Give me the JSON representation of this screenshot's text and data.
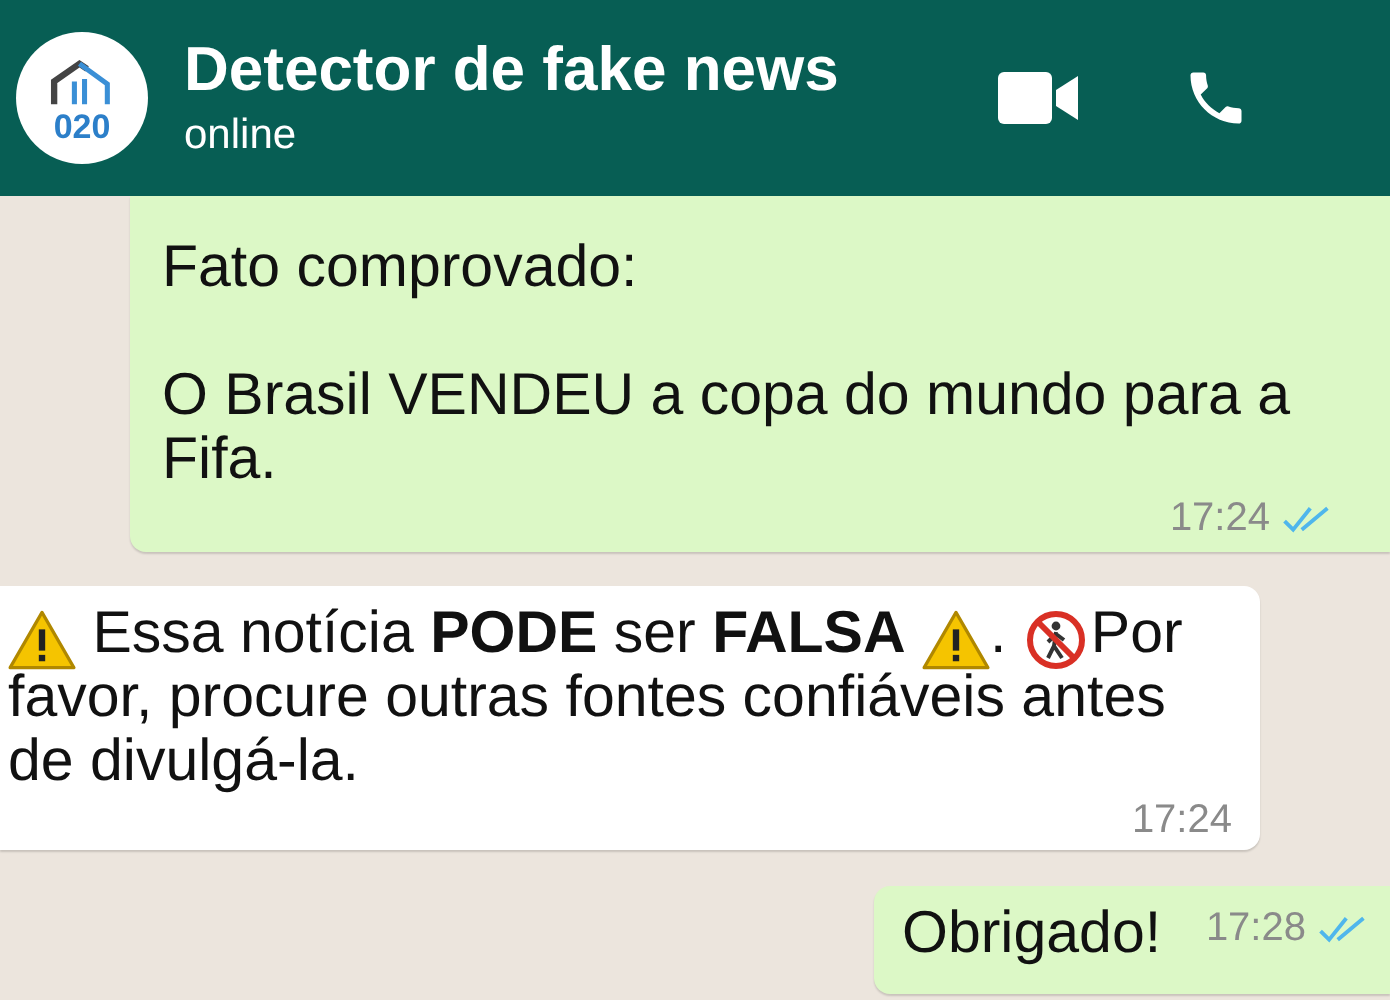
{
  "header": {
    "avatar_text": "020",
    "title": "Detector de fake news",
    "status": "online"
  },
  "messages": [
    {
      "kind": "outgoing",
      "segments": [
        {
          "kind": "text",
          "text": "Fato comprovado:"
        },
        {
          "kind": "break"
        },
        {
          "kind": "break"
        },
        {
          "kind": "text",
          "text": "O Brasil VENDEU a copa do mundo para a Fifa."
        }
      ],
      "time": "17:24",
      "read": true
    },
    {
      "kind": "incoming",
      "segments": [
        {
          "kind": "warning"
        },
        {
          "kind": "text",
          "text": " Essa notícia **PODE** ser **FALSA** "
        },
        {
          "kind": "warning"
        },
        {
          "kind": "text",
          "text": ". "
        },
        {
          "kind": "no-pedestrian"
        },
        {
          "kind": "text",
          "text": "Por favor, procure outras fontes confiáveis antes de divulgá-la."
        }
      ],
      "time": "17:24"
    },
    {
      "kind": "outgoing",
      "segments": [
        {
          "kind": "text",
          "text": "Obrigado!"
        }
      ],
      "time": "17:28",
      "read": true
    }
  ]
}
